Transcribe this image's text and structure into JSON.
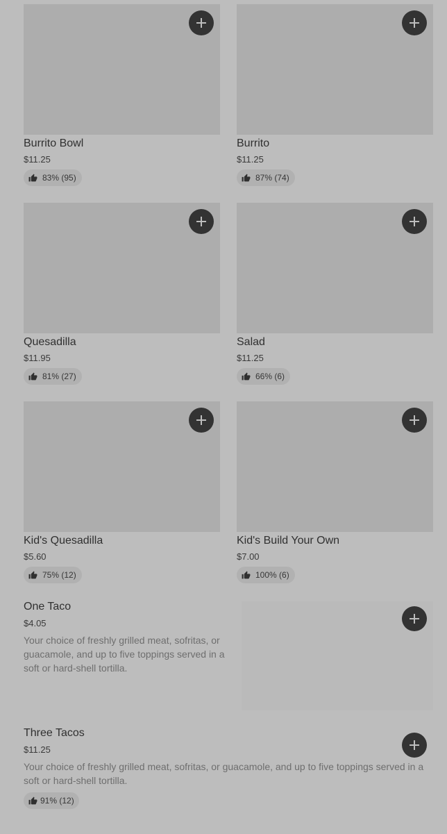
{
  "menu": {
    "items": [
      {
        "name": "Burrito Bowl",
        "price": "$11.25",
        "rating": "83% (95)"
      },
      {
        "name": "Burrito",
        "price": "$11.25",
        "rating": "87% (74)"
      },
      {
        "name": "Quesadilla",
        "price": "$11.95",
        "rating": "81% (27)"
      },
      {
        "name": "Salad",
        "price": "$11.25",
        "rating": "66% (6)"
      },
      {
        "name": "Kid's Quesadilla",
        "price": "$5.60",
        "rating": "75% (12)"
      },
      {
        "name": "Kid's Build Your Own",
        "price": "$7.00",
        "rating": "100% (6)"
      }
    ],
    "one_taco": {
      "name": "One Taco",
      "price": "$4.05",
      "description": "Your choice of freshly grilled meat, sofritas, or guacamole, and up to five toppings served in a soft or hard-shell tortilla."
    },
    "three_tacos": {
      "name": "Three Tacos",
      "price": "$11.25",
      "description": "Your choice of freshly grilled meat, sofritas, or guacamole, and up to five toppings served in a soft or hard-shell tortilla.",
      "rating": "91% (12)"
    }
  },
  "icons": {
    "add": "plus-icon",
    "rating": "thumbs-up-icon"
  },
  "colors": {
    "overlay_background": "#bdbdbd",
    "image_placeholder": "#adadad",
    "add_button": "#333333",
    "rating_pill": "#b1b1b1"
  }
}
